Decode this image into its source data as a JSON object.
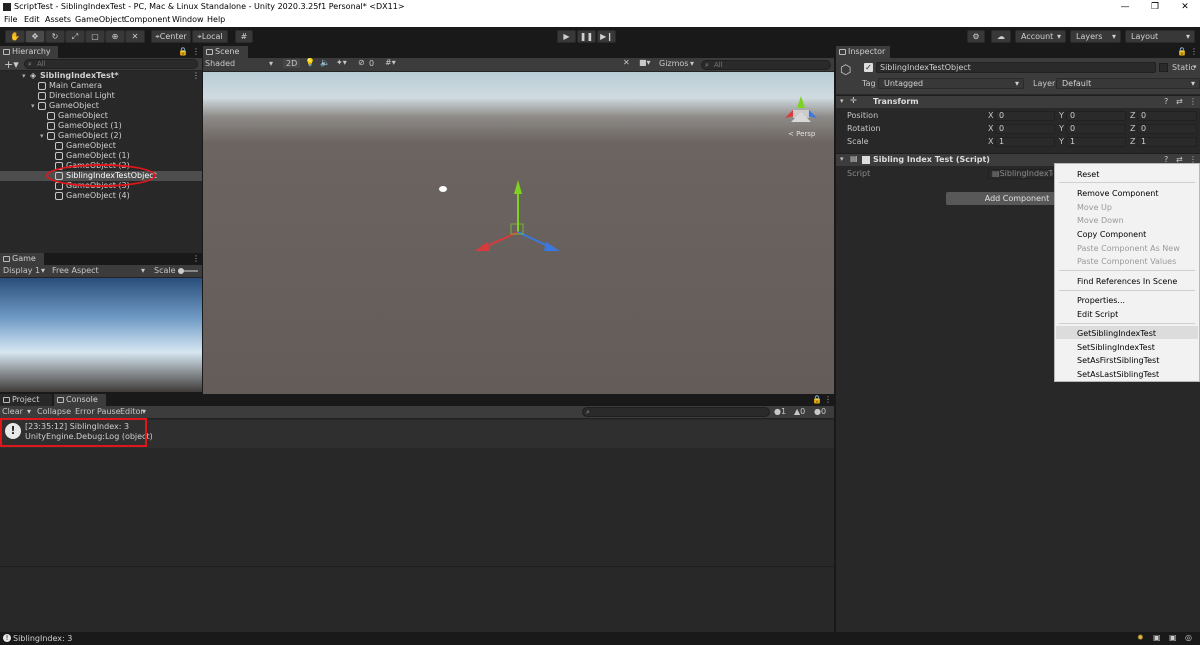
{
  "window": {
    "title": "ScriptTest - SiblingIndexTest - PC, Mac & Linux Standalone - Unity 2020.3.25f1 Personal* <DX11>",
    "minimize": "—",
    "maximize": "❐",
    "close": "✕"
  },
  "menu": [
    "File",
    "Edit",
    "Assets",
    "GameObject",
    "Component",
    "Window",
    "Help"
  ],
  "toolbar": {
    "tools": [
      "hand-tool",
      "move-tool",
      "rotate-tool",
      "scale-tool",
      "rect-tool",
      "transform-tool",
      "custom-tool"
    ],
    "pivot_label": "Center",
    "space_label": "Local",
    "play": "▶",
    "pause": "❚❚",
    "step": "▶❙",
    "account_label": "Account",
    "layers_label": "Layers",
    "layout_label": "Layout"
  },
  "hierarchy": {
    "tab_label": "Hierarchy",
    "search_placeholder": "All",
    "items": [
      {
        "label": "SiblingIndexTest*",
        "depth": 0,
        "bold": true
      },
      {
        "label": "Main Camera",
        "depth": 1
      },
      {
        "label": "Directional Light",
        "depth": 1
      },
      {
        "label": "GameObject",
        "depth": 1
      },
      {
        "label": "GameObject",
        "depth": 2
      },
      {
        "label": "GameObject (1)",
        "depth": 2
      },
      {
        "label": "GameObject (2)",
        "depth": 2
      },
      {
        "label": "GameObject",
        "depth": 3
      },
      {
        "label": "GameObject (1)",
        "depth": 3
      },
      {
        "label": "GameObject (2)",
        "depth": 3
      },
      {
        "label": "SiblingIndexTestObject",
        "depth": 3,
        "selected": true
      },
      {
        "label": "GameObject (3)",
        "depth": 3
      },
      {
        "label": "GameObject (4)",
        "depth": 3
      }
    ]
  },
  "game": {
    "tab_label": "Game",
    "display_label": "Display 1",
    "aspect_label": "Free Aspect",
    "scale_label": "Scale"
  },
  "scene": {
    "tab_label": "Scene",
    "shading_label": "Shaded",
    "mode_2d": "2D",
    "gizmos_label": "Gizmos",
    "search_placeholder": "All",
    "fx_count": "0",
    "persp_label": "Persp"
  },
  "console": {
    "tabs": [
      "Project",
      "Console"
    ],
    "clear_label": "Clear",
    "collapse_label": "Collapse",
    "error_pause_label": "Error Pause",
    "editor_label": "Editor",
    "counts": {
      "log": "1",
      "warn": "0",
      "error": "0"
    },
    "entries": [
      {
        "line1": "[23:35:12] SiblingIndex: 3",
        "line2": "UnityEngine.Debug:Log (object)"
      }
    ]
  },
  "inspector": {
    "tab_label": "Inspector",
    "object_name": "SiblingIndexTestObject",
    "static_label": "Static",
    "tag_label": "Tag",
    "tag_value": "Untagged",
    "layer_label": "Layer",
    "layer_value": "Default",
    "transform": {
      "header": "Transform",
      "rows": [
        {
          "label": "Position",
          "x": "0",
          "y": "0",
          "z": "0"
        },
        {
          "label": "Rotation",
          "x": "0",
          "y": "0",
          "z": "0"
        },
        {
          "label": "Scale",
          "x": "1",
          "y": "1",
          "z": "1"
        }
      ],
      "axis_x": "X",
      "axis_y": "Y",
      "axis_z": "Z"
    },
    "script_component": {
      "header": "Sibling Index Test (Script)",
      "script_label": "Script",
      "script_value": "SiblingIndexTest"
    },
    "add_component_label": "Add Component"
  },
  "context_menu": {
    "items": [
      {
        "label": "Reset",
        "disabled": false
      },
      {
        "sep": true
      },
      {
        "label": "Remove Component",
        "disabled": false
      },
      {
        "label": "Move Up",
        "disabled": true
      },
      {
        "label": "Move Down",
        "disabled": true
      },
      {
        "label": "Copy Component",
        "disabled": false
      },
      {
        "label": "Paste Component As New",
        "disabled": true
      },
      {
        "label": "Paste Component Values",
        "disabled": true
      },
      {
        "sep": true
      },
      {
        "label": "Find References In Scene",
        "disabled": false
      },
      {
        "sep": true
      },
      {
        "label": "Properties...",
        "disabled": false
      },
      {
        "label": "Edit Script",
        "disabled": false
      },
      {
        "sep": true
      },
      {
        "label": "GetSiblingIndexTest",
        "disabled": false,
        "hover": true
      },
      {
        "label": "SetSiblingIndexTest",
        "disabled": false
      },
      {
        "label": "SetAsFirstSiblingTest",
        "disabled": false
      },
      {
        "label": "SetAsLastSiblingTest",
        "disabled": false
      }
    ]
  },
  "status": {
    "message": "SiblingIndex: 3"
  },
  "colors": {
    "highlight_red": "#e0161b",
    "selection": "#4d4d4d",
    "axis_x": "#d83b3b",
    "axis_y": "#7ed321",
    "axis_z": "#3a78e0"
  }
}
